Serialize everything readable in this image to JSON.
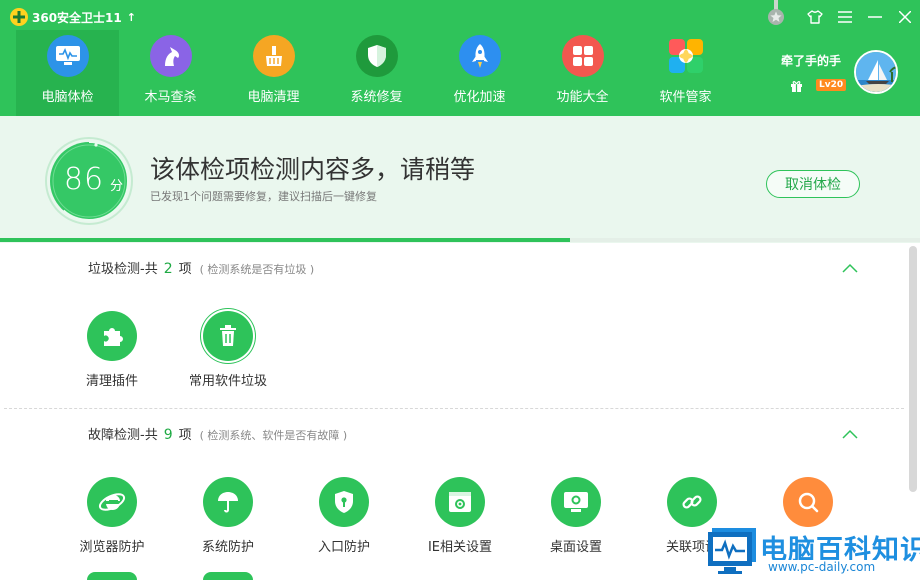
{
  "app": {
    "title": "360安全卫士11",
    "update_arrow": "↑"
  },
  "nav": [
    {
      "label": "电脑体检",
      "icon": "monitor-check-icon",
      "color": "#2d93e8",
      "active": true
    },
    {
      "label": "木马查杀",
      "icon": "horse-icon",
      "color": "#8a64e6"
    },
    {
      "label": "电脑清理",
      "icon": "broom-icon",
      "color": "#f5a623"
    },
    {
      "label": "系统修复",
      "icon": "shield-icon",
      "color": "#1f9a3c"
    },
    {
      "label": "优化加速",
      "icon": "rocket-icon",
      "color": "#2d8ff0"
    },
    {
      "label": "功能大全",
      "icon": "grid-icon",
      "color": "#f2584f"
    },
    {
      "label": "软件管家",
      "icon": "clover-icon",
      "color": "#ffb400"
    }
  ],
  "user": {
    "name": "牵了手的手",
    "level": "Lv20"
  },
  "scan": {
    "score": "86",
    "score_unit": "分",
    "title": "该体检项检测内容多，请稍等",
    "subtitle": "已发现1个问题需要修复，建议扫描后一键修复",
    "cancel_label": "取消体检",
    "progress": 0.62
  },
  "sections": [
    {
      "title": "垃圾检测-共",
      "count": "2",
      "unit": "项",
      "hint": "( 检测系统是否有垃圾 )",
      "items": [
        {
          "label": "清理插件",
          "icon": "puzzle-icon"
        },
        {
          "label": "常用软件垃圾",
          "icon": "trash-icon"
        }
      ]
    },
    {
      "title": "故障检测-共",
      "count": "9",
      "unit": "项",
      "hint": "( 检测系统、软件是否有故障 )",
      "items": [
        {
          "label": "浏览器防护",
          "icon": "ie-browser-icon"
        },
        {
          "label": "系统防护",
          "icon": "umbrella-icon"
        },
        {
          "label": "入口防护",
          "icon": "lock-shield-icon"
        },
        {
          "label": "IE相关设置",
          "icon": "ie-settings-icon"
        },
        {
          "label": "桌面设置",
          "icon": "desktop-icon"
        },
        {
          "label": "关联项设",
          "icon": "link-icon"
        },
        {
          "label": "",
          "icon": "search-icon"
        }
      ]
    }
  ],
  "watermark": {
    "text": "电脑百科知识",
    "url": "www.pc-daily.com"
  }
}
